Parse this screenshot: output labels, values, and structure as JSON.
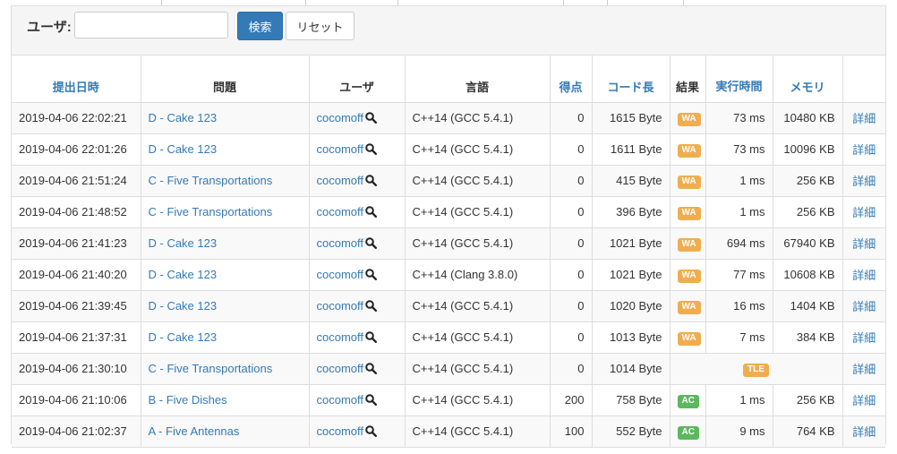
{
  "filter": {
    "user_label": "ユーザ:",
    "user_value": "",
    "search_button": "検索",
    "reset_button": "リセット"
  },
  "columns": {
    "submitted_at": "提出日時",
    "problem": "問題",
    "user": "ユーザ",
    "language": "言語",
    "score": "得点",
    "code_length": "コード長",
    "result": "結果",
    "exec_time": "実行時間",
    "memory": "メモリ"
  },
  "rows": [
    {
      "time": "2019-04-06 22:02:21",
      "problem": "D - Cake 123",
      "user": "cocomoff",
      "lang": "C++14 (GCC 5.4.1)",
      "score": "0",
      "length": "1615 Byte",
      "status": "WA",
      "exec": "73 ms",
      "memory": "10480 KB",
      "detail": "詳細"
    },
    {
      "time": "2019-04-06 22:01:26",
      "problem": "D - Cake 123",
      "user": "cocomoff",
      "lang": "C++14 (GCC 5.4.1)",
      "score": "0",
      "length": "1611 Byte",
      "status": "WA",
      "exec": "73 ms",
      "memory": "10096 KB",
      "detail": "詳細"
    },
    {
      "time": "2019-04-06 21:51:24",
      "problem": "C - Five Transportations",
      "user": "cocomoff",
      "lang": "C++14 (GCC 5.4.1)",
      "score": "0",
      "length": "415 Byte",
      "status": "WA",
      "exec": "1 ms",
      "memory": "256 KB",
      "detail": "詳細"
    },
    {
      "time": "2019-04-06 21:48:52",
      "problem": "C - Five Transportations",
      "user": "cocomoff",
      "lang": "C++14 (GCC 5.4.1)",
      "score": "0",
      "length": "396 Byte",
      "status": "WA",
      "exec": "1 ms",
      "memory": "256 KB",
      "detail": "詳細"
    },
    {
      "time": "2019-04-06 21:41:23",
      "problem": "D - Cake 123",
      "user": "cocomoff",
      "lang": "C++14 (GCC 5.4.1)",
      "score": "0",
      "length": "1021 Byte",
      "status": "WA",
      "exec": "694 ms",
      "memory": "67940 KB",
      "detail": "詳細"
    },
    {
      "time": "2019-04-06 21:40:20",
      "problem": "D - Cake 123",
      "user": "cocomoff",
      "lang": "C++14 (Clang 3.8.0)",
      "score": "0",
      "length": "1021 Byte",
      "status": "WA",
      "exec": "77 ms",
      "memory": "10608 KB",
      "detail": "詳細"
    },
    {
      "time": "2019-04-06 21:39:45",
      "problem": "D - Cake 123",
      "user": "cocomoff",
      "lang": "C++14 (GCC 5.4.1)",
      "score": "0",
      "length": "1020 Byte",
      "status": "WA",
      "exec": "16 ms",
      "memory": "1404 KB",
      "detail": "詳細"
    },
    {
      "time": "2019-04-06 21:37:31",
      "problem": "D - Cake 123",
      "user": "cocomoff",
      "lang": "C++14 (GCC 5.4.1)",
      "score": "0",
      "length": "1013 Byte",
      "status": "WA",
      "exec": "7 ms",
      "memory": "384 KB",
      "detail": "詳細"
    },
    {
      "time": "2019-04-06 21:30:10",
      "problem": "C - Five Transportations",
      "user": "cocomoff",
      "lang": "C++14 (GCC 5.4.1)",
      "score": "0",
      "length": "1014 Byte",
      "status": "TLE",
      "exec": "",
      "memory": "",
      "detail": "詳細"
    },
    {
      "time": "2019-04-06 21:10:06",
      "problem": "B - Five Dishes",
      "user": "cocomoff",
      "lang": "C++14 (GCC 5.4.1)",
      "score": "200",
      "length": "758 Byte",
      "status": "AC",
      "exec": "1 ms",
      "memory": "256 KB",
      "detail": "詳細"
    },
    {
      "time": "2019-04-06 21:02:37",
      "problem": "A - Five Antennas",
      "user": "cocomoff",
      "lang": "C++14 (GCC 5.4.1)",
      "score": "100",
      "length": "552 Byte",
      "status": "AC",
      "exec": "9 ms",
      "memory": "764 KB",
      "detail": "詳細"
    }
  ],
  "colors": {
    "link": "#337ab7",
    "warning": "#f0ad4e",
    "success": "#5cb85c"
  }
}
